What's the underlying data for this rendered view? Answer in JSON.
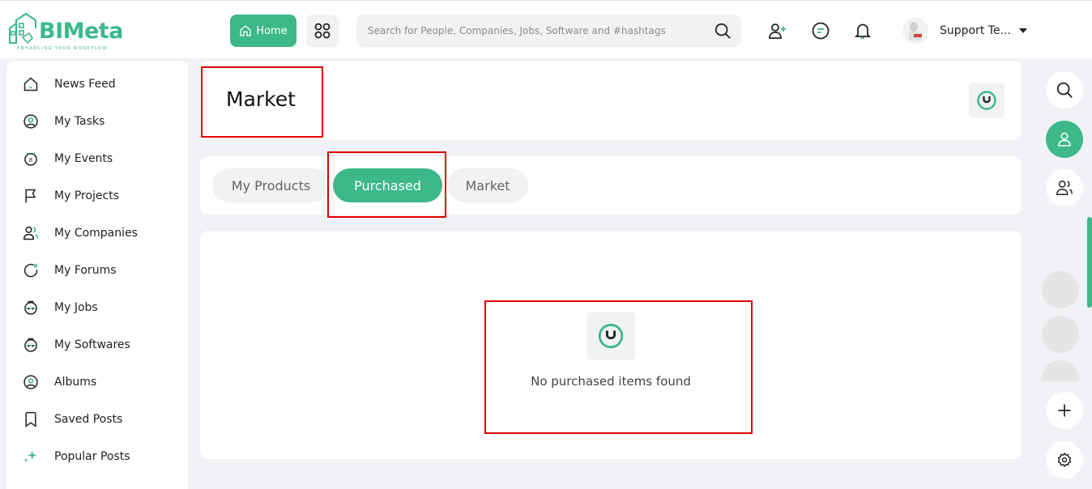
{
  "brand": {
    "name": "BIMeta",
    "tagline": "ENHANCING YOUR WORKFLOW",
    "color": "#3cb88b"
  },
  "header": {
    "home_label": "Home",
    "search_placeholder": "Search for People, Companies, Jobs, Software and #hashtags",
    "user_name": "Support Te...",
    "icons": [
      "home-icon",
      "apps-grid-icon",
      "search-icon",
      "add-user-icon",
      "chat-icon",
      "bell-icon",
      "caret-down-icon"
    ]
  },
  "sidebar": {
    "items": [
      {
        "label": "News Feed",
        "icon": "home-icon"
      },
      {
        "label": "My Tasks",
        "icon": "user-circle-icon"
      },
      {
        "label": "My Events",
        "icon": "calendar-icon"
      },
      {
        "label": "My Projects",
        "icon": "flag-icon"
      },
      {
        "label": "My Companies",
        "icon": "users-icon"
      },
      {
        "label": "My Forums",
        "icon": "forum-icon"
      },
      {
        "label": "My Jobs",
        "icon": "briefcase-icon"
      },
      {
        "label": "My Softwares",
        "icon": "software-icon"
      },
      {
        "label": "Albums",
        "icon": "album-icon"
      },
      {
        "label": "Saved Posts",
        "icon": "bookmark-icon"
      },
      {
        "label": "Popular Posts",
        "icon": "sparkle-icon"
      }
    ]
  },
  "main": {
    "title": "Market",
    "tabs": [
      {
        "label": "My Products",
        "active": false
      },
      {
        "label": "Purchased",
        "active": true
      },
      {
        "label": "Market",
        "active": false
      }
    ],
    "empty_message": "No purchased items found"
  },
  "right_rail": {
    "icons": [
      "search-icon",
      "user-icon",
      "group-icon",
      "plus-icon",
      "gear-icon"
    ]
  },
  "colors": {
    "accent": "#3cb88b",
    "annotation": "#e00000",
    "background": "#f0f2f5"
  }
}
